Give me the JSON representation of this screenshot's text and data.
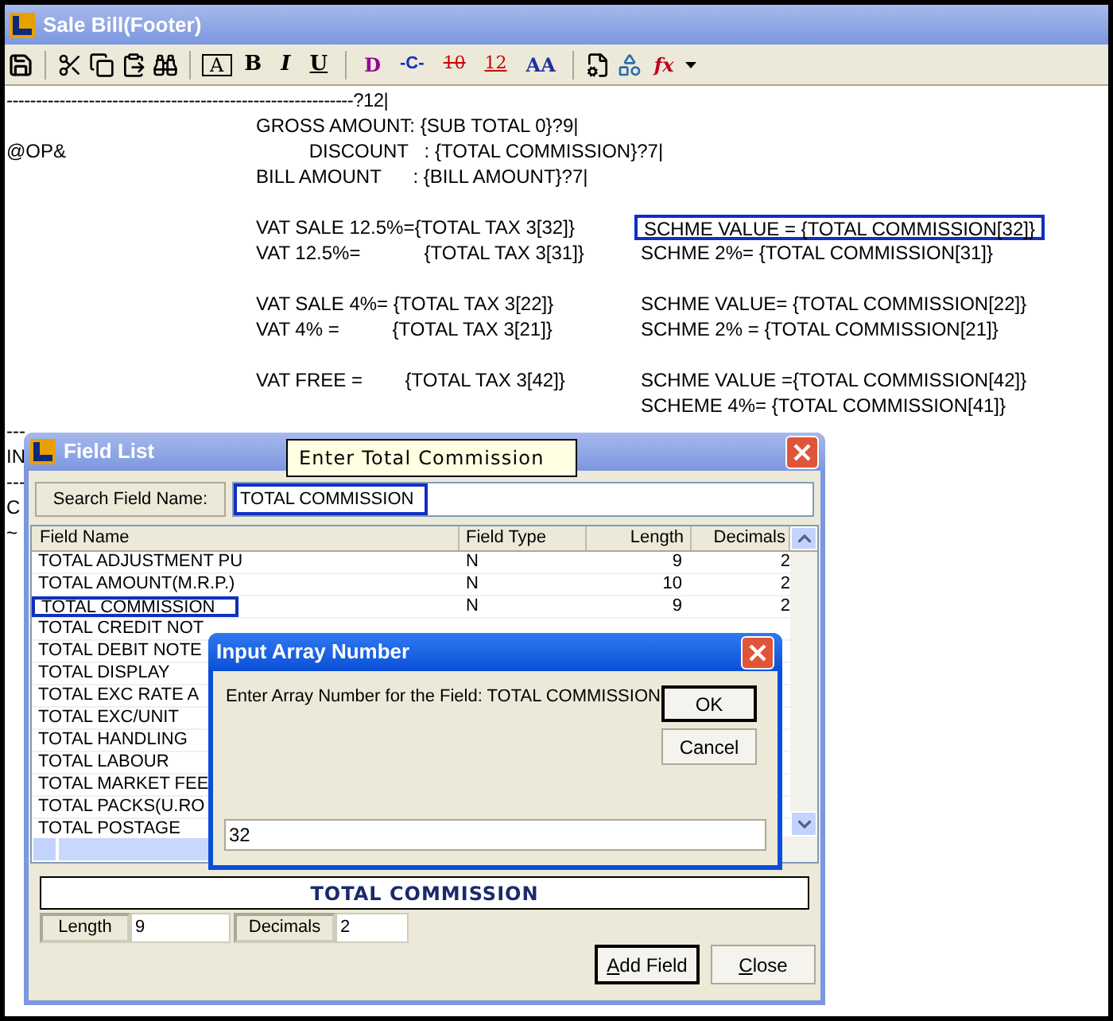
{
  "window": {
    "title": "Sale Bill(Footer)"
  },
  "toolbar": {
    "glyphs": [
      {
        "kind": "boxed",
        "text": "A"
      },
      {
        "kind": "bold",
        "text": "B"
      },
      {
        "kind": "italic",
        "text": "I"
      },
      {
        "kind": "underline",
        "text": "U"
      },
      {
        "kind": "purple",
        "text": "D"
      },
      {
        "kind": "connector",
        "text": "-C-"
      },
      {
        "kind": "red-strike",
        "text": "10"
      },
      {
        "kind": "red-under",
        "text": "12"
      },
      {
        "kind": "double",
        "text": "AA"
      }
    ],
    "function_glyph": "fx"
  },
  "editor": {
    "lines": [
      {
        "kind": "rule",
        "text": "-----------------------------------------------------------?12|"
      },
      {
        "kind": "text",
        "left": "GROSS AMOUNT: {SUB TOTAL 0}?9|"
      },
      {
        "kind": "text",
        "margin": "@OP&",
        "left": "          DISCOUNT   : {TOTAL COMMISSION}?7|"
      },
      {
        "kind": "text",
        "left": "BILL AMOUNT      : {BILL AMOUNT}?7|"
      },
      {
        "kind": "gap"
      },
      {
        "kind": "text",
        "left": "VAT SALE 12.5%={TOTAL TAX 3[32]}",
        "right": "SCHME VALUE = {TOTAL COMMISSION[32]}",
        "highlighted": true
      },
      {
        "kind": "text",
        "left": "VAT 12.5%=            {TOTAL TAX 3[31]}",
        "right": "SCHME 2%= {TOTAL COMMISSION[31]}",
        "highlighted": false
      },
      {
        "kind": "gap"
      },
      {
        "kind": "text",
        "left": "VAT SALE 4%= {TOTAL TAX 3[22]}",
        "right": "SCHME VALUE= {TOTAL COMMISSION[22]}",
        "highlighted": false
      },
      {
        "kind": "text",
        "left": "VAT 4% =          {TOTAL TAX 3[21]}",
        "right": "SCHME 2% = {TOTAL COMMISSION[21]}",
        "highlighted": false
      },
      {
        "kind": "gap"
      },
      {
        "kind": "text",
        "left": "VAT FREE =        {TOTAL TAX 3[42]}",
        "right": "SCHME VALUE ={TOTAL COMMISSION[42]}",
        "highlighted": false
      },
      {
        "kind": "text",
        "right": "SCHEME 4%= {TOTAL COMMISSION[41]}",
        "highlighted": false
      },
      {
        "kind": "text",
        "margin": "---"
      },
      {
        "kind": "text",
        "margin": "IN"
      },
      {
        "kind": "text",
        "margin": "---"
      },
      {
        "kind": "text",
        "margin": "C"
      },
      {
        "kind": "text",
        "margin": "~"
      }
    ]
  },
  "field_list": {
    "title": "Field List",
    "tooltip": "Enter Total Commission",
    "search_label": "Search Field Name:",
    "search_value": "TOTAL COMMISSION",
    "columns": [
      "Field Name",
      "Field Type",
      "Length",
      "Decimals"
    ],
    "rows": [
      {
        "name": "TOTAL ADJUSTMENT PU",
        "type": "N",
        "length": "9",
        "decimals": "2",
        "selected": false
      },
      {
        "name": "TOTAL AMOUNT(M.R.P.)",
        "type": "N",
        "length": "10",
        "decimals": "2",
        "selected": false
      },
      {
        "name": "TOTAL COMMISSION",
        "type": "N",
        "length": "9",
        "decimals": "2",
        "selected": true
      },
      {
        "name": "TOTAL CREDIT NOT",
        "selected": false
      },
      {
        "name": "TOTAL DEBIT NOTE",
        "selected": false
      },
      {
        "name": "TOTAL DISPLAY",
        "selected": false
      },
      {
        "name": "TOTAL EXC RATE A",
        "selected": false
      },
      {
        "name": "TOTAL EXC/UNIT",
        "selected": false
      },
      {
        "name": "TOTAL HANDLING",
        "selected": false
      },
      {
        "name": "TOTAL LABOUR",
        "selected": false
      },
      {
        "name": "TOTAL MARKET FEE",
        "selected": false
      },
      {
        "name": "TOTAL PACKS(U.RO",
        "selected": false
      },
      {
        "name": "TOTAL POSTAGE",
        "selected": false
      }
    ],
    "current_field": "TOTAL COMMISSION",
    "length_label": "Length",
    "length_value": "9",
    "decimals_label": "Decimals",
    "decimals_value": "2",
    "buttons": [
      "Add Field",
      "Close"
    ]
  },
  "array_dialog": {
    "title": "Input Array Number",
    "prompt": "Enter Array Number for the Field: TOTAL COMMISSION",
    "value": "32",
    "buttons": [
      "OK",
      "Cancel"
    ]
  }
}
